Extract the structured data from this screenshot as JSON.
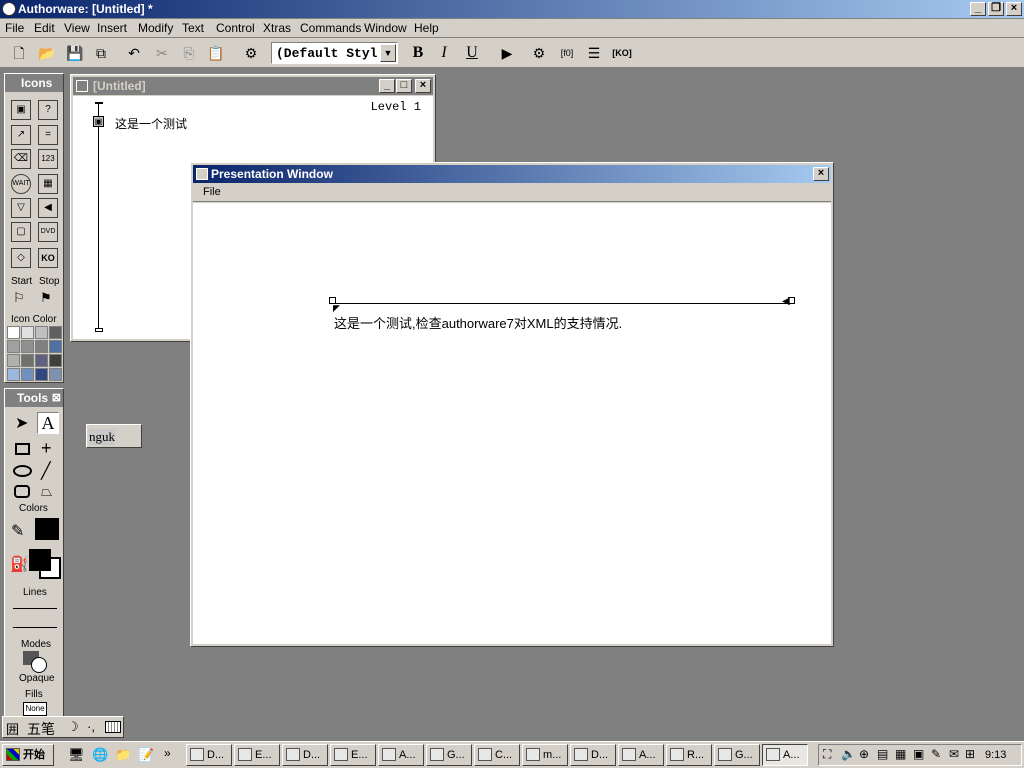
{
  "app": {
    "title": "Authorware: [Untitled] *"
  },
  "menu": [
    "File",
    "Edit",
    "View",
    "Insert",
    "Modify",
    "Text",
    "Control",
    "Xtras",
    "Commands",
    "Window",
    "Help"
  ],
  "toolbar": {
    "style_select": "(Default Styl"
  },
  "icons_palette": {
    "title": "Icons",
    "start": "Start",
    "stop": "Stop",
    "icon_color": "Icon Color",
    "cells": [
      "",
      "?",
      "",
      "=",
      "",
      "123",
      "WAIT",
      "",
      "",
      "",
      "",
      "DVD",
      "",
      "KO"
    ]
  },
  "tools": {
    "title": "Tools",
    "colors": "Colors",
    "lines": "Lines",
    "modes": "Modes",
    "mode_value": "Opaque",
    "fills": "Fills",
    "fill_value": "None"
  },
  "flow_window": {
    "title": "[Untitled]",
    "level": "Level 1",
    "item": "这是一个测试"
  },
  "floating_field": {
    "value": "nguk"
  },
  "presentation": {
    "title": "Presentation Window",
    "menu": "File",
    "text": "这是一个测试,检查authorware7对XML的支持情况."
  },
  "ime": {
    "mode": "五笔"
  },
  "taskbar": {
    "start": "开始",
    "clock": "9:13",
    "tasks": [
      "D...",
      "E...",
      "D...",
      "E...",
      "A...",
      "G...",
      "C...",
      "m...",
      "D...",
      "A...",
      "R...",
      "G...",
      "A..."
    ]
  },
  "colors": {
    "title_start": "#0a246a",
    "title_end": "#a6caf0",
    "face": "#d4d0c8",
    "desktop": "#808080"
  }
}
